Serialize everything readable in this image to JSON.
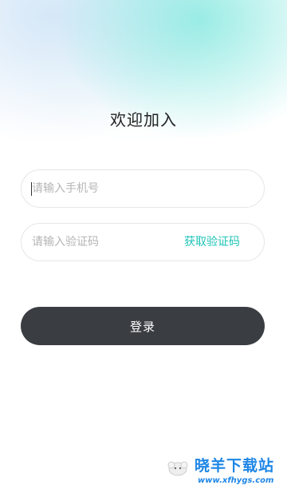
{
  "page": {
    "title": "欢迎加入"
  },
  "form": {
    "phone_placeholder": "请输入手机号",
    "code_placeholder": "请输入验证码",
    "get_code_label": "获取验证码",
    "login_label": "登录"
  },
  "watermark": {
    "name": "晓羊下载站",
    "url": "www.xfhygs.com",
    "icon": "sheep-icon"
  },
  "colors": {
    "accent": "#20c4b8",
    "button": "#3a3d42",
    "watermark": "#1e86e6"
  }
}
